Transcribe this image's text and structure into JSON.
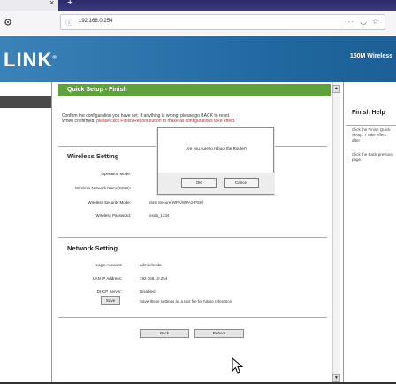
{
  "browser": {
    "tab_close": "×",
    "new_tab": "+",
    "url": "192.168.0.254",
    "more": "···"
  },
  "header": {
    "brand": "LINK",
    "brand_mark": "®",
    "model": "150M Wireless"
  },
  "panel": {
    "title": "Quick Setup - Finish",
    "confirm_line1": "Confirm the configuration you have set. If anything is wrong, please go BACK to reset.",
    "confirm_line2": "When confirmed,",
    "confirm_red": "please click Finish/Reboot button to make all configurations take effect.",
    "wireless": {
      "title": "Wireless Setting",
      "rows": [
        {
          "label": "Operation Mode:",
          "value": ""
        },
        {
          "label": "Wireless Network Name(SSID):",
          "value": ""
        },
        {
          "label": "Wireless Security Mode:",
          "value": "Most Secure(WPA/WPA2-PSK)"
        },
        {
          "label": "Wireless Password:",
          "value": "tesda_1234"
        }
      ]
    },
    "network": {
      "title": "Network Setting",
      "rows": [
        {
          "label": "Login Account:",
          "value": "admin/tesda"
        },
        {
          "label": "LAN IP Address:",
          "value": "192.168.10.254"
        },
        {
          "label": "DHCP Server:",
          "value": "Disabled"
        }
      ]
    },
    "save_button": "Save",
    "save_note": "Save these settings as a text file for future reference",
    "back_button": "Back",
    "reboot_button": "Reboot"
  },
  "help": {
    "title": "Finish Help",
    "para1": "Click the Finish Quick Setup. T take effect after",
    "para2": "Click the Back previous page."
  },
  "dialog": {
    "message": "Are you sure to reboot the Router?",
    "ok": "OK",
    "cancel": "Cancel"
  },
  "colors": {
    "header_blue": "#2068a0",
    "title_green": "#5fa13a",
    "confirm_red": "#cc2222"
  }
}
